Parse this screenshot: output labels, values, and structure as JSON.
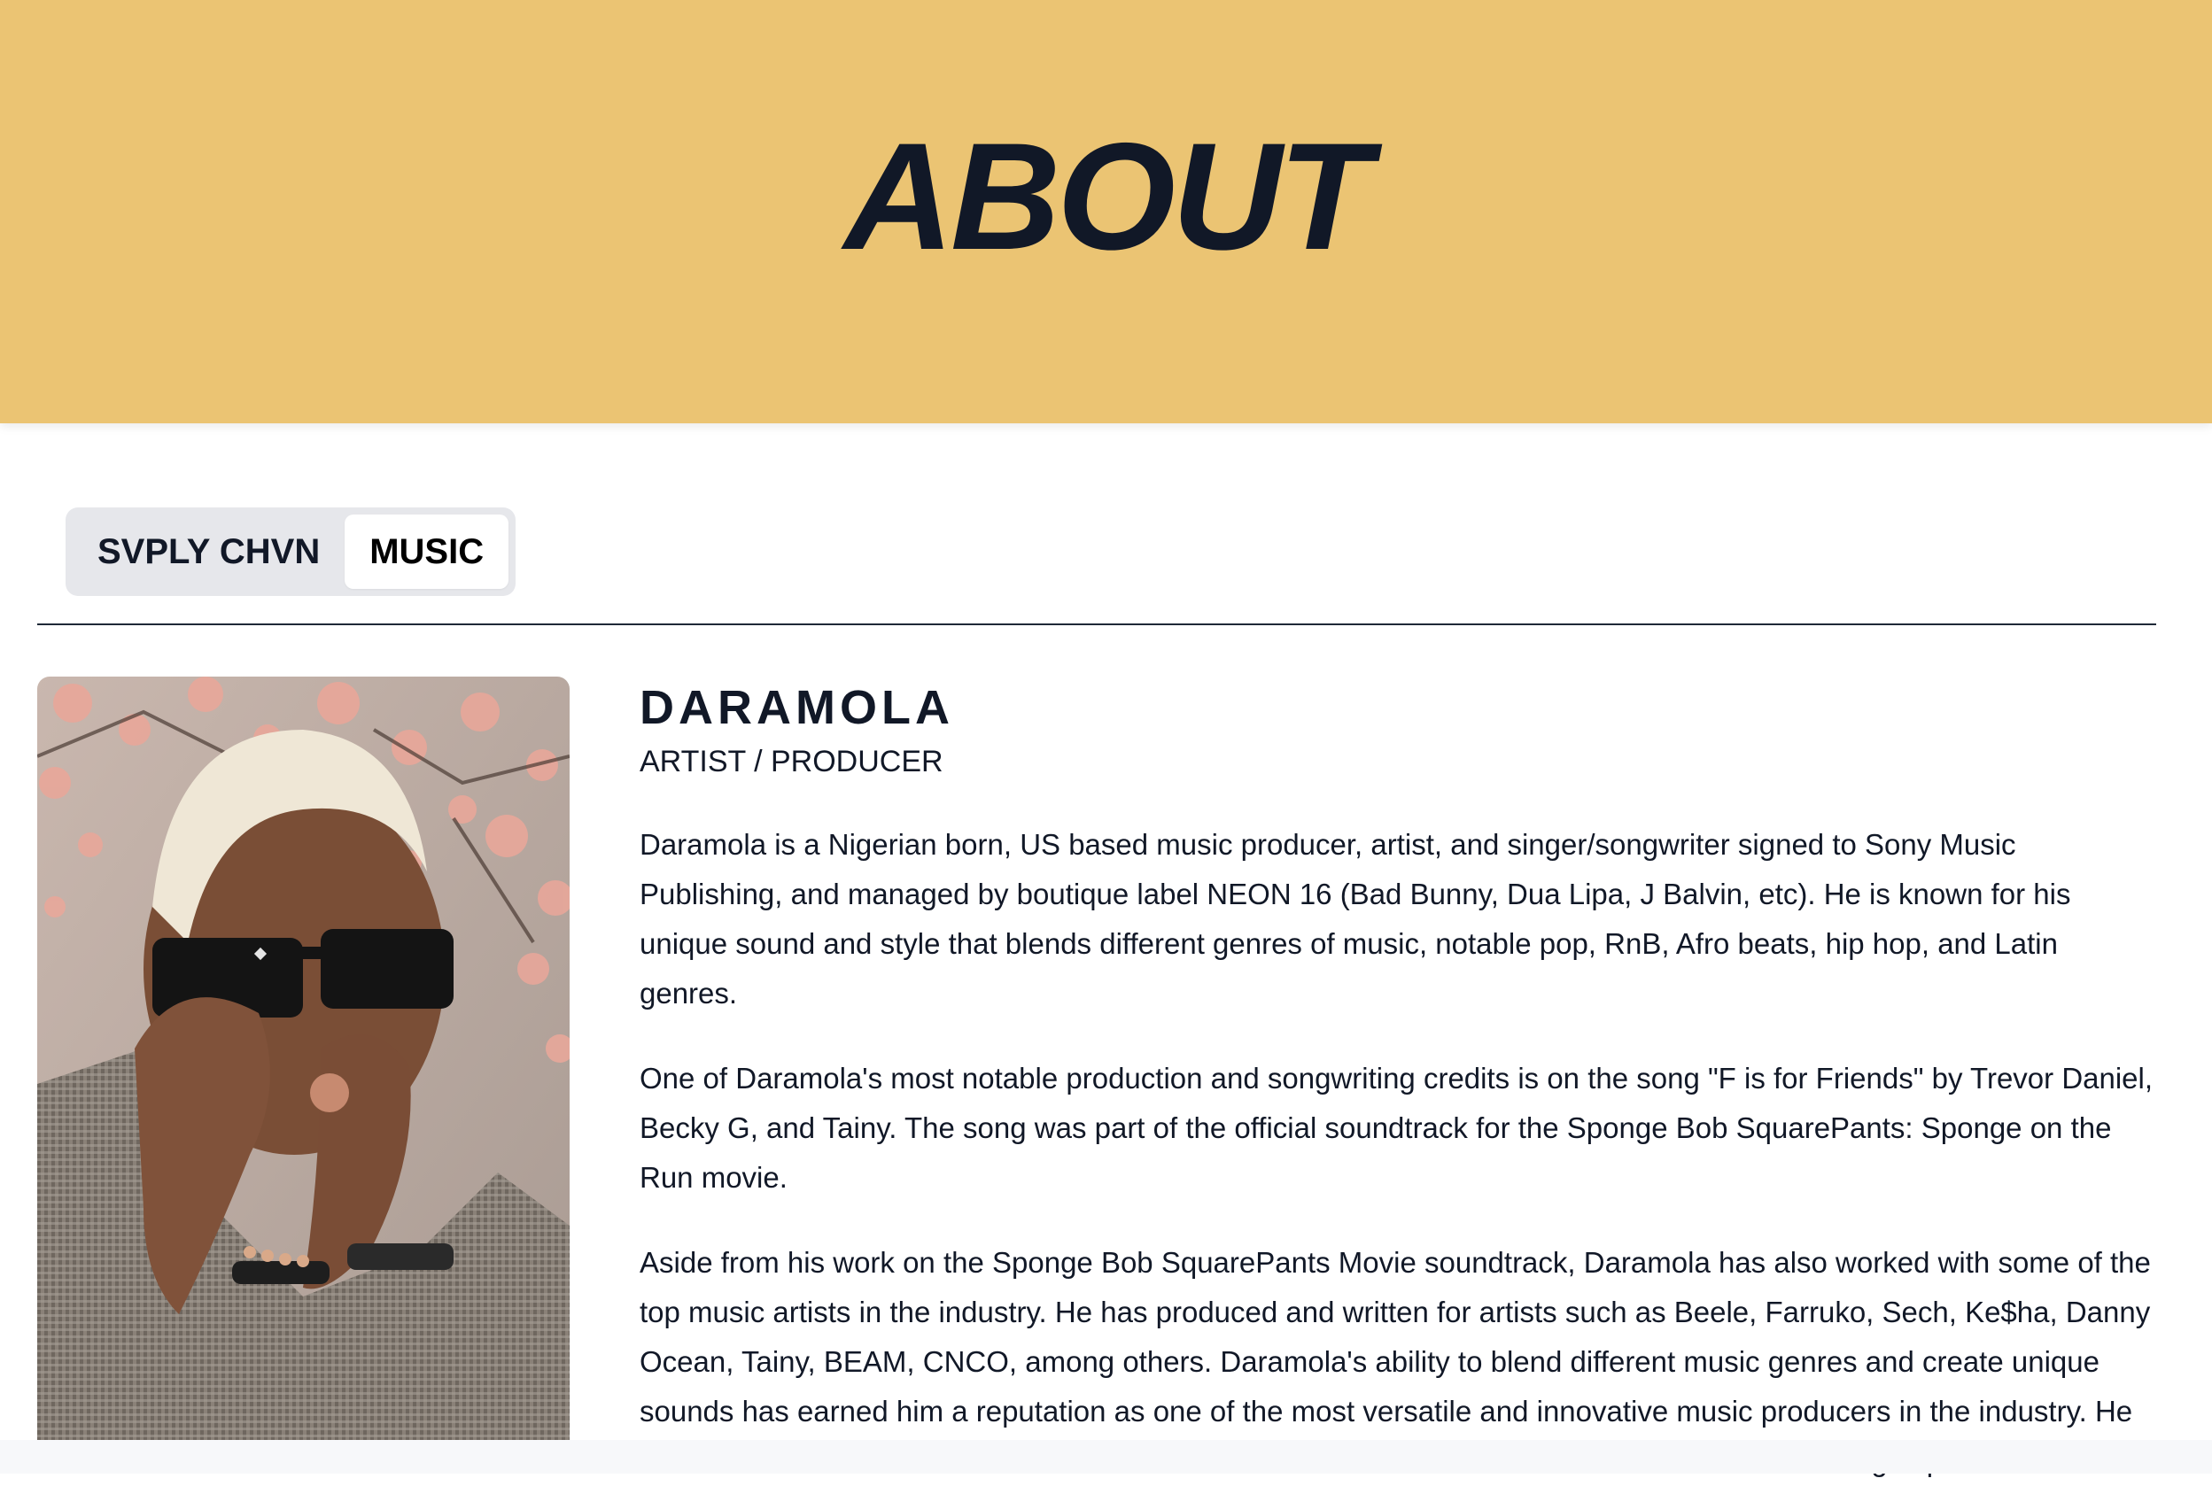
{
  "hero": {
    "title": "ABOUT",
    "background_color": "#ebc473"
  },
  "tabs": [
    {
      "label": "SVPLY CHVN",
      "active": false
    },
    {
      "label": "MUSIC",
      "active": true
    }
  ],
  "profile": {
    "photo_icon": "portrait-photo",
    "name": "DARAMOLA",
    "role": "ARTIST / PRODUCER",
    "paragraphs": [
      "Daramola is a Nigerian born, US based music producer, artist, and singer/songwriter signed to Sony Music Publishing, and managed by boutique label NEON 16 (Bad Bunny, Dua Lipa, J Balvin, etc). He is known for his unique sound and style that blends different genres of music, notable pop, RnB, Afro beats, hip hop, and Latin genres.",
      "One of Daramola's most notable production and songwriting credits is on the song \"F is for Friends\" by Trevor Daniel, Becky G, and Tainy. The song was part of the official soundtrack for the Sponge Bob SquarePants: Sponge on the Run movie.",
      "Aside from his work on the Sponge Bob SquarePants Movie soundtrack, Daramola has also worked with some of the top music artists in the industry. He has produced and written for artists such as Beele, Farruko, Sech, Ke$ha, Danny Ocean, Tainy, BEAM, CNCO, among others. Daramola's ability to blend different music genres and create unique sounds has earned him a reputation as one of the most versatile and innovative music producers in the industry. He continues to create music that resonates with fans across the world and is sure to leave a lasting impact on the music"
    ]
  }
}
